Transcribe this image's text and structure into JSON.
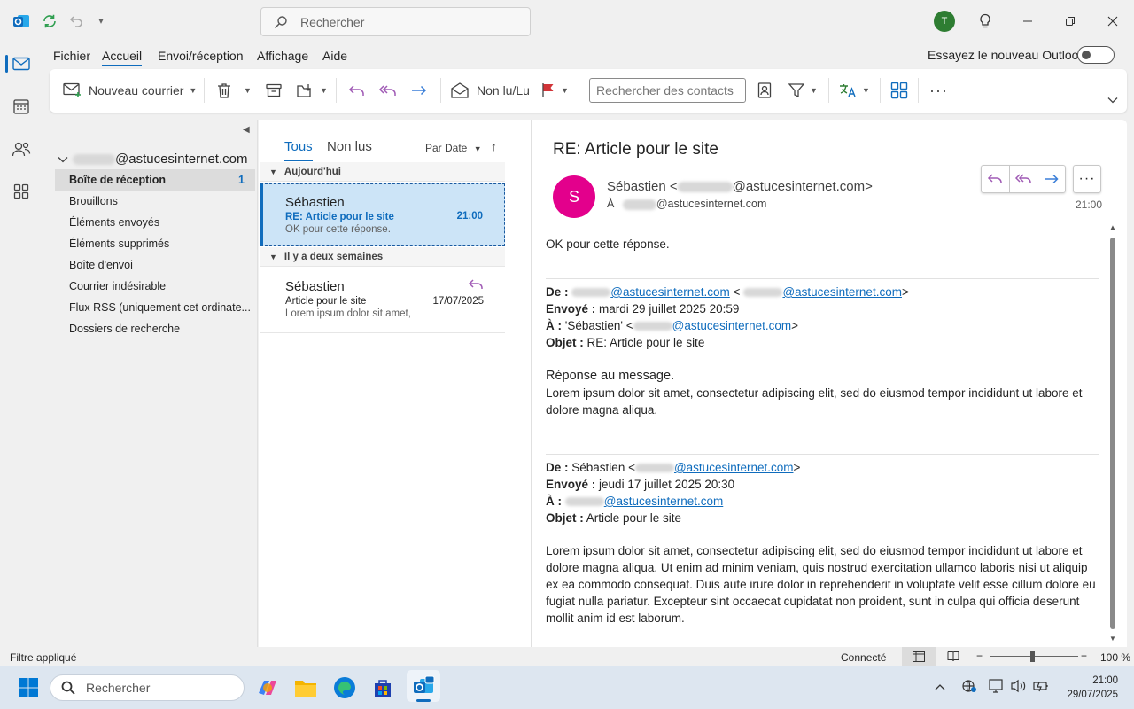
{
  "titlebar": {
    "search_placeholder": "Rechercher",
    "user_initial": "T"
  },
  "menu": {
    "tabs": [
      "Fichier",
      "Accueil",
      "Envoi/réception",
      "Affichage",
      "Aide"
    ],
    "try_new_label": "Essayez le nouveau Outlook"
  },
  "ribbon": {
    "new_mail": "Nouveau courrier",
    "unread_read": "Non lu/Lu",
    "contact_search_placeholder": "Rechercher des contacts"
  },
  "folders": {
    "account_domain": "@astucesinternet.com",
    "items": [
      {
        "label": "Boîte de réception",
        "count": "1"
      },
      {
        "label": "Brouillons"
      },
      {
        "label": "Éléments envoyés"
      },
      {
        "label": "Éléments supprimés"
      },
      {
        "label": "Boîte d'envoi"
      },
      {
        "label": "Courrier indésirable"
      },
      {
        "label": "Flux RSS (uniquement cet ordinate..."
      },
      {
        "label": "Dossiers de recherche"
      }
    ]
  },
  "list": {
    "filter_all": "Tous",
    "filter_unread": "Non lus",
    "sort_label": "Par Date",
    "groups": [
      "Aujourd'hui",
      "Il y a deux semaines"
    ],
    "messages": [
      {
        "sender": "Sébastien",
        "subject": "RE: Article pour le site",
        "time": "21:00",
        "preview": "OK pour cette réponse."
      },
      {
        "sender": "Sébastien",
        "subject": "Article pour le site",
        "time": "17/07/2025",
        "preview": "Lorem ipsum dolor sit amet,"
      }
    ]
  },
  "reading": {
    "subject": "RE: Article pour le site",
    "avatar_initial": "S",
    "from_name": "Sébastien <",
    "from_domain": "@astucesinternet.com>",
    "to_prefix": "À",
    "to_domain": "@astucesinternet.com",
    "time": "21:00",
    "body_first": "OK pour cette réponse.",
    "quote1": {
      "de_label": "De :",
      "domain": "@astucesinternet.com",
      "sent_label": "Envoyé :",
      "sent": "mardi 29 juillet 2025 20:59",
      "to_label": "À :",
      "to_name": "'Sébastien' <",
      "subject_label": "Objet :",
      "subject": "RE: Article pour le site",
      "heading": "Réponse au message.",
      "text": "Lorem ipsum dolor sit amet, consectetur adipiscing elit, sed do eiusmod tempor incididunt ut labore et dolore magna aliqua."
    },
    "quote2": {
      "de_label": "De :",
      "from_name": "Sébastien <",
      "domain": "@astucesinternet.com",
      "sent_label": "Envoyé :",
      "sent": "jeudi 17 juillet 2025 20:30",
      "to_label": "À :",
      "subject_label": "Objet :",
      "subject": "Article pour le site",
      "text": "Lorem ipsum dolor sit amet, consectetur adipiscing elit, sed do eiusmod tempor incididunt ut labore et dolore magna aliqua. Ut enim ad minim veniam, quis nostrud exercitation ullamco laboris nisi ut aliquip ex ea commodo consequat. Duis aute irure dolor in reprehenderit in voluptate velit esse cillum dolore eu fugiat nulla pariatur. Excepteur sint occaecat cupidatat non proident, sunt in culpa qui officia deserunt mollit anim id est laborum."
    }
  },
  "status": {
    "filter": "Filtre appliqué",
    "connection": "Connecté",
    "zoom": "100 %"
  },
  "taskbar": {
    "search_placeholder": "Rechercher",
    "time": "21:00",
    "date": "29/07/2025"
  },
  "colors": {
    "accent": "#0f6cbd",
    "avatar_s": "#e3008c",
    "avatar_t": "#2e7d32",
    "selected": "#cce4f7"
  }
}
